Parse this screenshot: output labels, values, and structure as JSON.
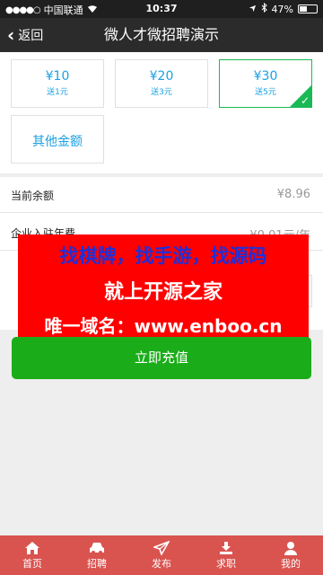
{
  "status_bar": {
    "carrier": "中国联通",
    "time": "10:37",
    "battery": "47%",
    "battery_level": 0.47
  },
  "nav": {
    "back_label": "返回",
    "title": "微人才微招聘演示"
  },
  "amounts": [
    {
      "price": "¥10",
      "bonus": "送1元",
      "selected": false
    },
    {
      "price": "¥20",
      "bonus": "送3元",
      "selected": false
    },
    {
      "price": "¥30",
      "bonus": "送5元",
      "selected": true
    }
  ],
  "other_amount_label": "其他金额",
  "info_rows": [
    {
      "label": "当前余额",
      "value": "¥8.96"
    },
    {
      "label": "企业入驻年费",
      "value": "¥0.01元/年"
    }
  ],
  "banner": {
    "line1": "找棋牌，找手游，找源码",
    "line2": "就上开源之家",
    "line3": "唯一域名：www.enboo.cn"
  },
  "recharge_button": "立即充值",
  "tabs": [
    {
      "label": "首页",
      "icon": "home-icon"
    },
    {
      "label": "招聘",
      "icon": "car-icon"
    },
    {
      "label": "发布",
      "icon": "send-icon"
    },
    {
      "label": "求职",
      "icon": "download-icon"
    },
    {
      "label": "我的",
      "icon": "user-icon"
    }
  ],
  "colors": {
    "accent": "#1aad19",
    "tabbar": "#d9534f",
    "price_text": "#1ba1e2",
    "banner_bg": "#ff0000"
  }
}
